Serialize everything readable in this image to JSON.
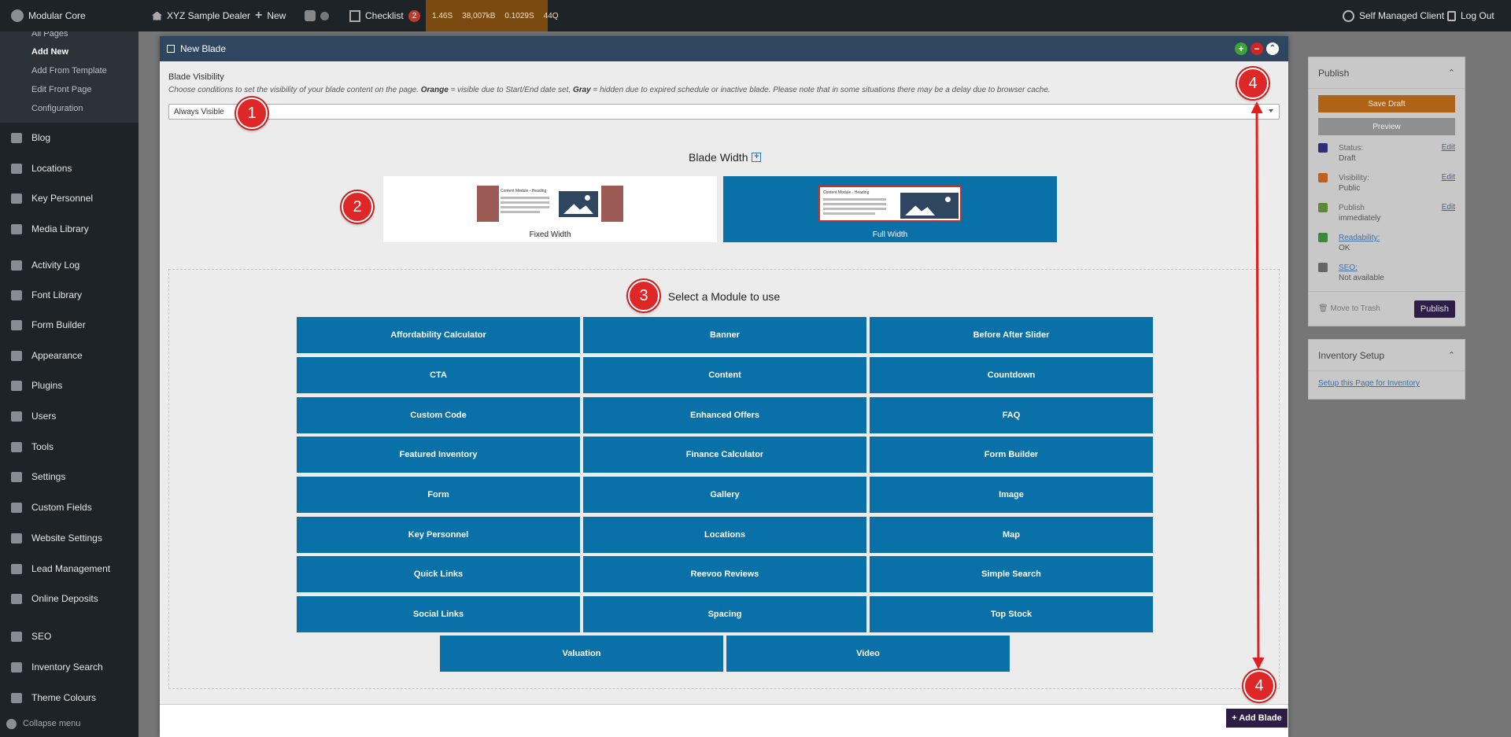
{
  "adminbar": {
    "site": "Modular Core",
    "dealer": "XYZ Sample Dealer",
    "new": "New",
    "checklist": "Checklist",
    "checklist_count": "2",
    "qm": {
      "time": "1.46S",
      "memory": "38,007kB",
      "db_time": "0.1029S",
      "queries": "44Q"
    },
    "user": "Self Managed Client",
    "logout": "Log Out"
  },
  "sidebar": {
    "submenu": [
      "All Pages",
      "Add New",
      "Add From Template",
      "Edit Front Page",
      "Configuration"
    ],
    "active_sub": "Add New",
    "items": [
      {
        "label": "Blog",
        "icon": "edit-icon"
      },
      {
        "label": "Locations",
        "icon": "pin-icon"
      },
      {
        "label": "Key Personnel",
        "icon": "users-icon"
      },
      {
        "label": "Media Library",
        "icon": "media-icon"
      },
      {
        "label": "Activity Log",
        "icon": "history-icon"
      },
      {
        "label": "Font Library",
        "icon": "paragraph-icon"
      },
      {
        "label": "Form Builder",
        "icon": "form-icon"
      },
      {
        "label": "Appearance",
        "icon": "brush-icon"
      },
      {
        "label": "Plugins",
        "icon": "plugin-icon"
      },
      {
        "label": "Users",
        "icon": "users-icon"
      },
      {
        "label": "Tools",
        "icon": "wrench-icon"
      },
      {
        "label": "Settings",
        "icon": "settings-icon"
      },
      {
        "label": "Custom Fields",
        "icon": "table-icon"
      },
      {
        "label": "Website Settings",
        "icon": "gear-icon"
      },
      {
        "label": "Lead Management",
        "icon": "chart-icon"
      },
      {
        "label": "Online Deposits",
        "icon": "card-icon"
      },
      {
        "label": "SEO",
        "icon": "yoast-icon"
      },
      {
        "label": "Inventory Search",
        "icon": "car-icon"
      },
      {
        "label": "Theme Colours",
        "icon": "palette-icon"
      }
    ],
    "collapse": "Collapse menu"
  },
  "publish_box": {
    "title": "Publish",
    "save_draft": "Save Draft",
    "preview": "Preview",
    "rows": [
      {
        "label": "Status:",
        "value": "Draft",
        "edit": "Edit",
        "color": "#2e2e7a"
      },
      {
        "label": "Visibility:",
        "value": "Public",
        "edit": "Edit",
        "color": "#c06020"
      },
      {
        "label": "Publish",
        "value": "immediately",
        "edit": "Edit",
        "color": "#5a8a3a"
      },
      {
        "label": "Readability:",
        "value": "OK",
        "edit": "",
        "color": "#3a8a3a"
      },
      {
        "label": "SEO:",
        "value": "Not available",
        "edit": "",
        "color": "#666666"
      }
    ],
    "trash": "Move to Trash",
    "publish": "Publish"
  },
  "inventory_box": {
    "title": "Inventory Setup",
    "link": "Setup this Page for Inventory"
  },
  "modal": {
    "title": "New Blade",
    "visibility_label": "Blade Visibility",
    "visibility_desc_1": "Choose conditions to set the visibility of your blade content on the page.",
    "visibility_orange": "Orange",
    "visibility_desc_2": "= visible due to Start/End date set,",
    "visibility_gray": "Gray",
    "visibility_desc_3": "= hidden due to expired schedule or inactive blade. Please note that in some situations there may be a delay due to browser cache.",
    "visibility_value": "Always Visible",
    "blade_width_title": "Blade Width",
    "fixed_width": "Fixed Width",
    "full_width": "Full Width",
    "thumb_heading": "Content Module - Heading",
    "module_title": "Select a Module to use",
    "modules": [
      "Affordability Calculator",
      "Banner",
      "Before After Slider",
      "CTA",
      "Content",
      "Countdown",
      "Custom Code",
      "Enhanced Offers",
      "FAQ",
      "Featured Inventory",
      "Finance Calculator",
      "Form Builder",
      "Form",
      "Gallery",
      "Image",
      "Key Personnel",
      "Locations",
      "Map",
      "Quick Links",
      "Reevoo Reviews",
      "Simple Search",
      "Social Links",
      "Spacing",
      "Top Stock",
      "Valuation",
      "Video"
    ],
    "add_blade": "+ Add Blade"
  },
  "callouts": [
    "1",
    "2",
    "3",
    "4",
    "4"
  ],
  "colors": {
    "module_blue": "#0a70a8",
    "callout_red": "#e02727",
    "header_navy": "#2e4660"
  }
}
